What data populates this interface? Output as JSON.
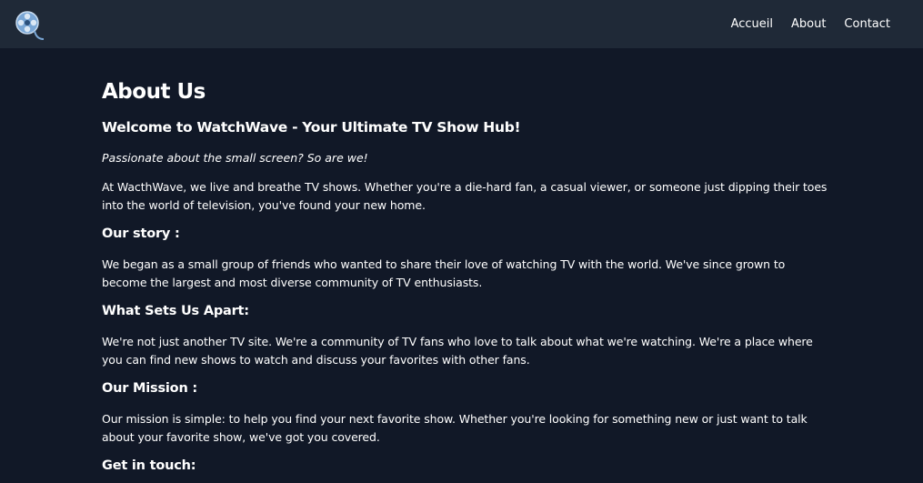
{
  "nav": {
    "logo_icon": "film-reel-icon",
    "links": [
      {
        "label": "Accueil"
      },
      {
        "label": "About"
      },
      {
        "label": "Contact"
      }
    ]
  },
  "page": {
    "title": "About Us",
    "subtitle": "Welcome to WatchWave - Your Ultimate TV Show Hub!",
    "tagline": "Passionate about the small screen? So are we!",
    "intro": "At WacthWave, we live and breathe TV shows. Whether you're a die-hard fan, a casual viewer, or someone just dipping their toes into the world of television, you've found your new home.",
    "sections": [
      {
        "heading": "Our story :",
        "text": "We began as a small group of friends who wanted to share their love of watching TV with the world. We've since grown to become the largest and most diverse community of TV enthusiasts."
      },
      {
        "heading": "What Sets Us Apart:",
        "text": "We're not just another TV site. We're a community of TV fans who love to talk about what we're watching. We're a place where you can find new shows to watch and discuss your favorites with other fans."
      },
      {
        "heading": "Our Mission :",
        "text": "Our mission is simple: to help you find your next favorite show. Whether you're looking for something new or just want to talk about your favorite show, we've got you covered."
      },
      {
        "heading": "Get in touch:"
      }
    ]
  },
  "colors": {
    "background": "#111827",
    "navbar": "#1f2937",
    "text": "#ffffff"
  }
}
